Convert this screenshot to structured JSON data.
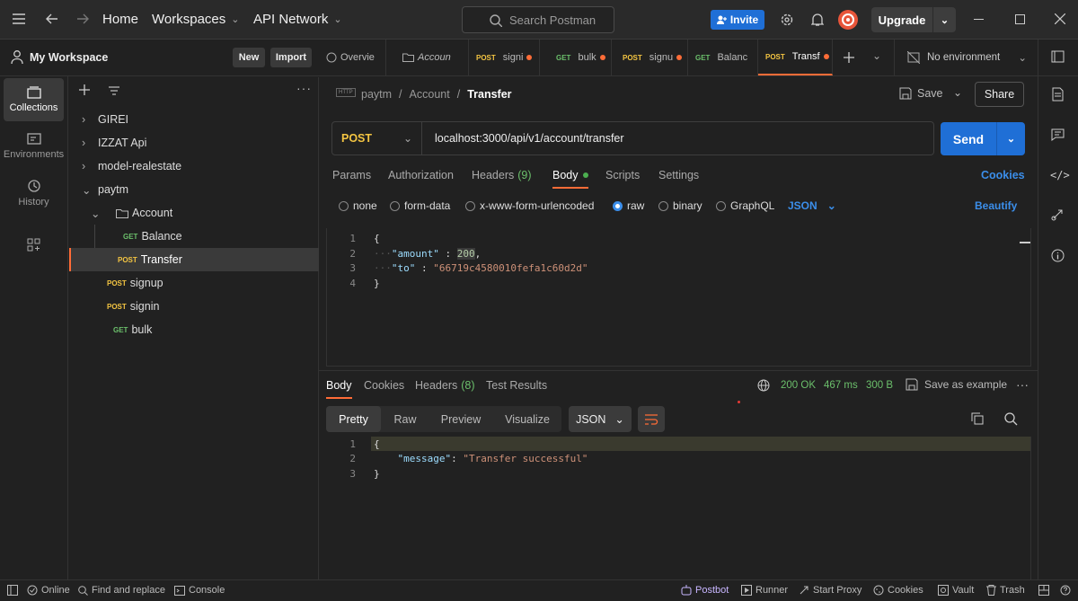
{
  "titlebar": {
    "home": "Home",
    "workspaces": "Workspaces",
    "api_network": "API Network",
    "search_placeholder": "Search Postman",
    "invite": "Invite",
    "upgrade": "Upgrade"
  },
  "sidebar": {
    "workspace_name": "My Workspace",
    "new_label": "New",
    "import_label": "Import",
    "rail": [
      {
        "label": "Collections",
        "icon": "collections-icon"
      },
      {
        "label": "Environments",
        "icon": "environments-icon"
      },
      {
        "label": "History",
        "icon": "history-icon"
      }
    ],
    "tree": [
      {
        "label": "GIREI"
      },
      {
        "label": "IZZAT Api"
      },
      {
        "label": "model-realestate"
      },
      {
        "label": "paytm"
      },
      {
        "label": "Account"
      },
      {
        "method": "GET",
        "label": "Balance"
      },
      {
        "method": "POST",
        "label": "Transfer"
      },
      {
        "method": "POST",
        "label": "signup"
      },
      {
        "method": "POST",
        "label": "signin"
      },
      {
        "method": "GET",
        "label": "bulk"
      }
    ]
  },
  "tabs": [
    {
      "label": "Overvie"
    },
    {
      "label": "Accoun"
    },
    {
      "method": "POST",
      "label": "signi"
    },
    {
      "method": "GET",
      "label": "bulk"
    },
    {
      "method": "POST",
      "label": "signu"
    },
    {
      "method": "GET",
      "label": "Balanc"
    },
    {
      "method": "POST",
      "label": "Transf"
    }
  ],
  "environment": "No environment",
  "request": {
    "breadcrumb": [
      "paytm",
      "Account",
      "Transfer"
    ],
    "breadcrumb_icon_text": "HTTP",
    "save": "Save",
    "share": "Share",
    "method": "POST",
    "url": "localhost:3000/api/v1/account/transfer",
    "send": "Send",
    "subtabs": {
      "params": "Params",
      "authorization": "Authorization",
      "headers": "Headers",
      "headers_count": "(9)",
      "body": "Body",
      "scripts": "Scripts",
      "settings": "Settings",
      "cookies": "Cookies"
    },
    "body_types": [
      "none",
      "form-data",
      "x-www-form-urlencoded",
      "raw",
      "binary",
      "GraphQL"
    ],
    "body_format": "JSON",
    "beautify": "Beautify",
    "body_lines": {
      "l1": "{",
      "amount_key": "\"amount\"",
      "amount_val": "200",
      "to_key": "\"to\"",
      "to_val": "\"66719c4580010fefa1c60d2d\"",
      "l4": "}"
    }
  },
  "response": {
    "tabs": {
      "body": "Body",
      "cookies": "Cookies",
      "headers": "Headers",
      "headers_count": "(8)",
      "test_results": "Test Results"
    },
    "status": "200 OK",
    "time": "467 ms",
    "size": "300 B",
    "save_example": "Save as example",
    "views": [
      "Pretty",
      "Raw",
      "Preview",
      "Visualize"
    ],
    "format": "JSON",
    "lines": {
      "l1": "{",
      "msg_key": "\"message\"",
      "msg_val": "\"Transfer successful\"",
      "l3": "}"
    }
  },
  "statusbar": {
    "online": "Online",
    "find_replace": "Find and replace",
    "console": "Console",
    "postbot": "Postbot",
    "runner": "Runner",
    "start_proxy": "Start Proxy",
    "cookies": "Cookies",
    "vault": "Vault",
    "trash": "Trash"
  },
  "colors": {
    "accent": "#ff6c37",
    "send": "#1f6fd6",
    "get": "#6bbf6b",
    "post": "#f4c542"
  }
}
